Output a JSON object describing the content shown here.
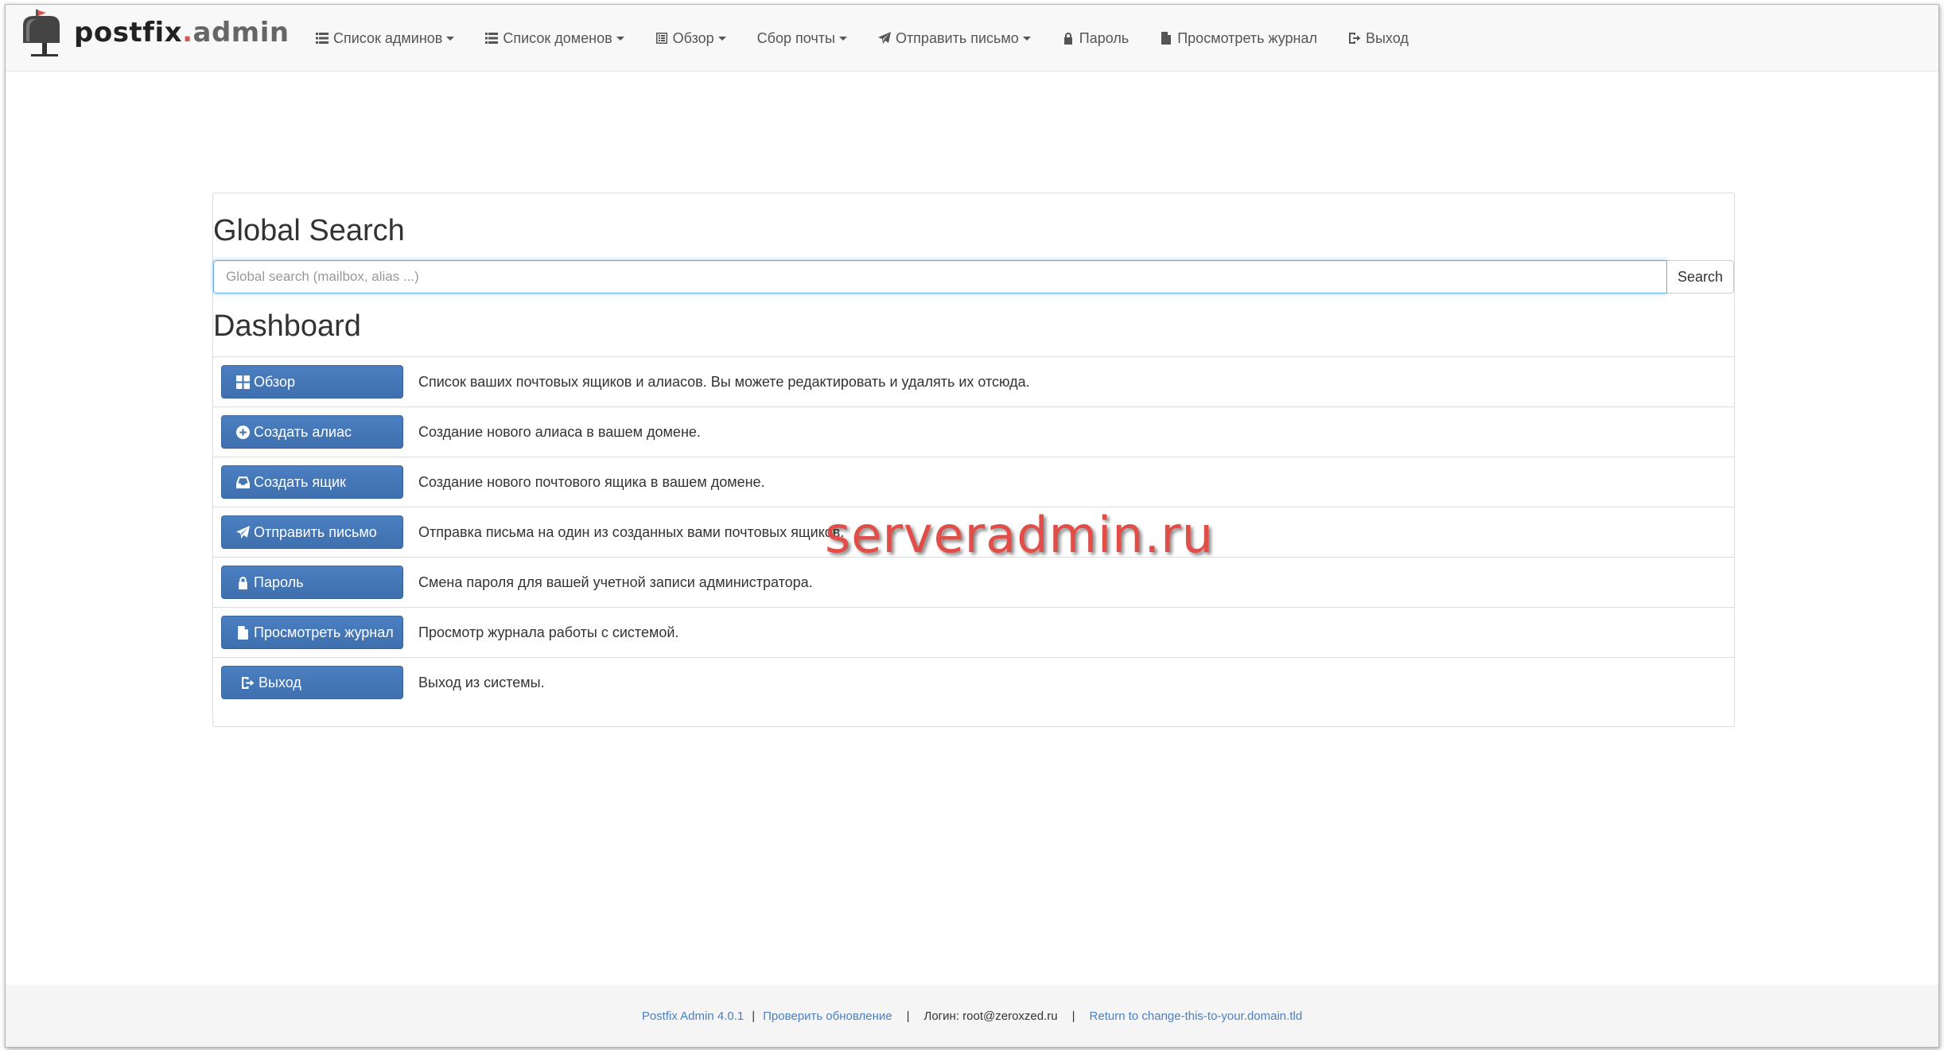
{
  "brand": {
    "part1": "postfix",
    "part2": ".",
    "part3": "admin"
  },
  "nav": [
    {
      "label": "Список админов",
      "icon": "list-icon",
      "caret": true
    },
    {
      "label": "Список доменов",
      "icon": "list-icon",
      "caret": true
    },
    {
      "label": "Обзор",
      "icon": "list-alt-icon",
      "caret": true
    },
    {
      "label": "Сбор почты",
      "icon": "",
      "caret": true
    },
    {
      "label": "Отправить письмо",
      "icon": "send-icon",
      "caret": true
    },
    {
      "label": "Пароль",
      "icon": "lock-icon",
      "caret": false
    },
    {
      "label": "Просмотреть журнал",
      "icon": "file-icon",
      "caret": false
    },
    {
      "label": "Выход",
      "icon": "logout-icon",
      "caret": false
    }
  ],
  "search": {
    "heading": "Global Search",
    "placeholder": "Global search (mailbox, alias ...)",
    "button": "Search"
  },
  "dashboard": {
    "heading": "Dashboard",
    "rows": [
      {
        "button": "Обзор",
        "icon": "th-large-icon",
        "description": "Список ваших почтовых ящиков и алиасов. Вы можете редактировать и удалять их отсюда."
      },
      {
        "button": "Создать алиас",
        "icon": "plus-circle-icon",
        "description": "Создание нового алиаса в вашем домене."
      },
      {
        "button": "Создать ящик",
        "icon": "inbox-icon",
        "description": "Создание нового почтового ящика в вашем домене."
      },
      {
        "button": "Отправить письмо",
        "icon": "send-icon",
        "description": "Отправка письма на один из созданных вами почтовых ящиков."
      },
      {
        "button": "Пароль",
        "icon": "lock-icon",
        "description": "Смена пароля для вашей учетной записи администратора."
      },
      {
        "button": "Просмотреть журнал",
        "icon": "file-icon",
        "description": "Просмотр журнала работы с системой."
      },
      {
        "button": "Выход",
        "icon": "logout-icon",
        "description": "Выход из системы."
      }
    ]
  },
  "watermark": "serveradmin.ru",
  "footer": {
    "version": "Postfix Admin 4.0.1",
    "check_update": "Проверить обновление",
    "login": "Логин: root@zeroxzed.ru",
    "return_link": "Return to change-this-to-your.domain.tld"
  },
  "colors": {
    "primary_button": "#4a7fc1",
    "link": "#4a7fc1",
    "watermark": "#e0443e",
    "brand_dot": "#d9534f"
  }
}
